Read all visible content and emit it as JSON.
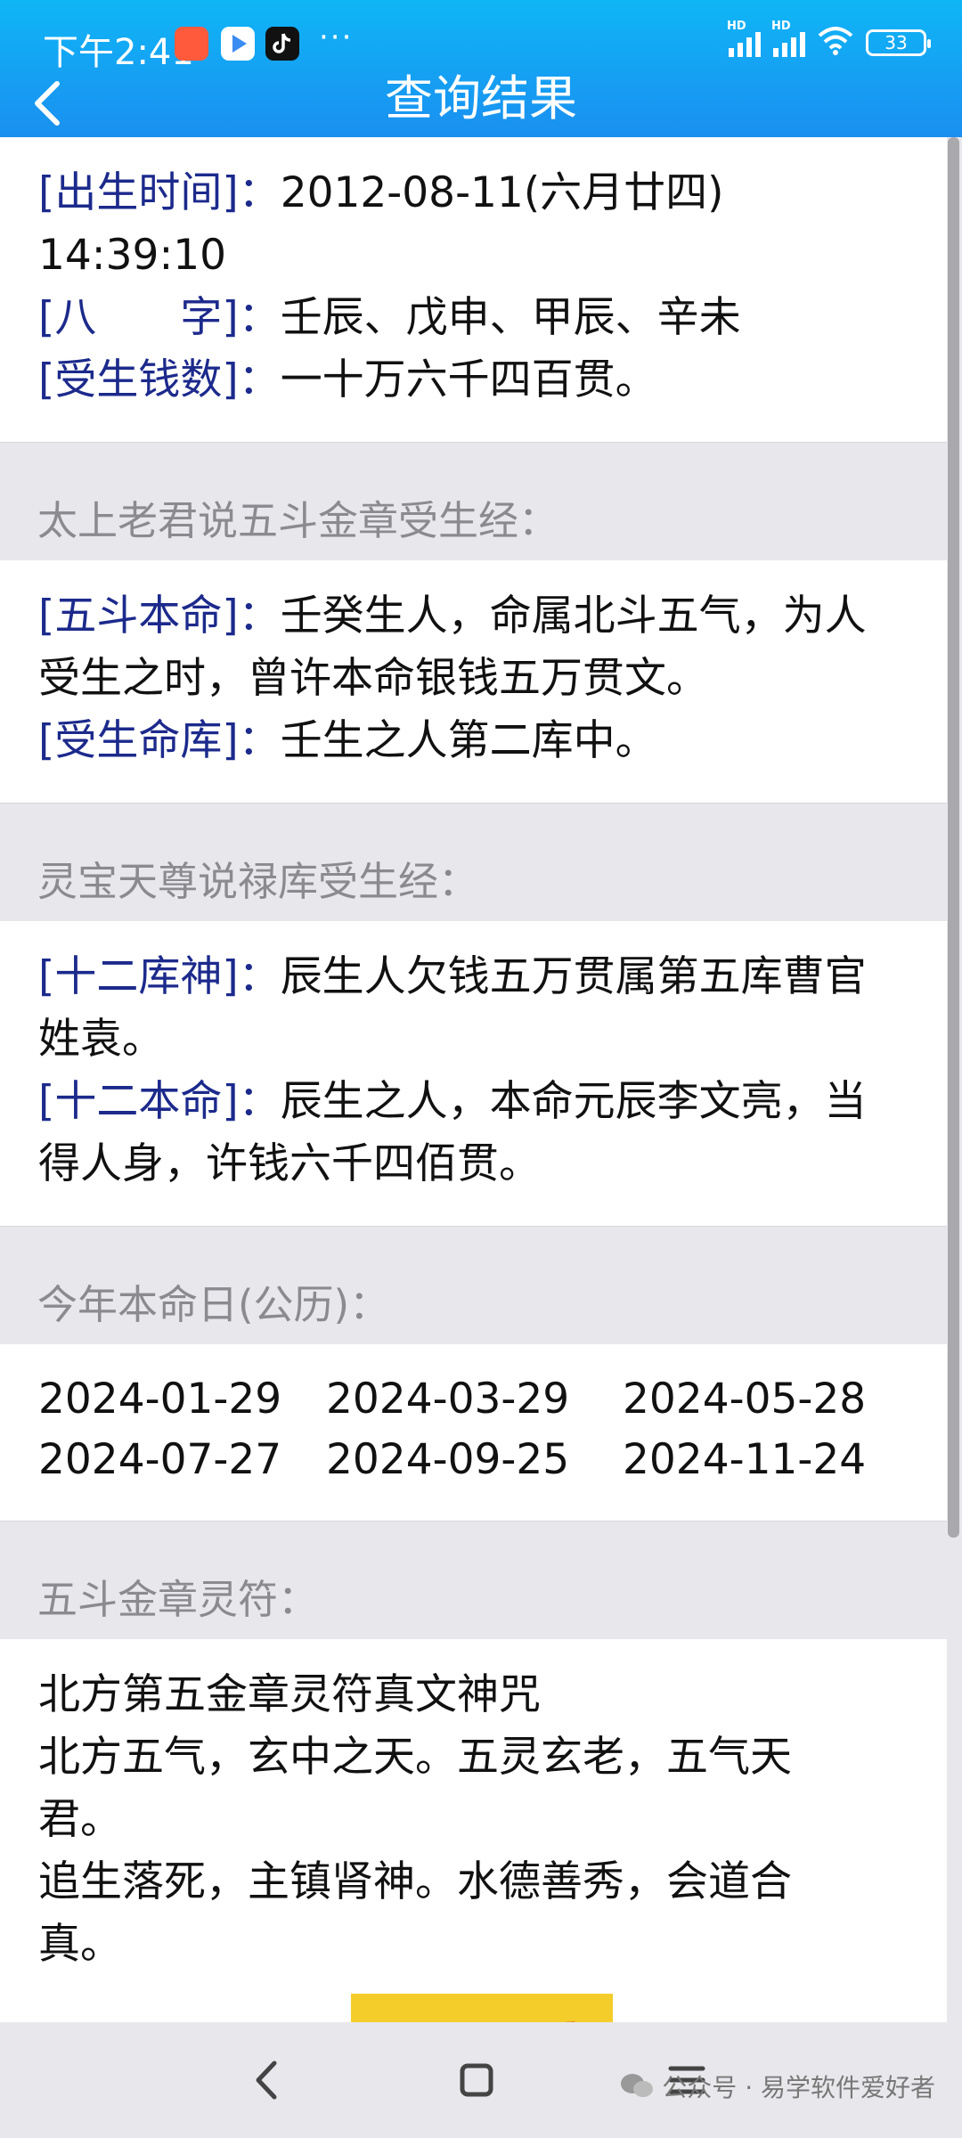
{
  "status_bar": {
    "time": "下午2:41",
    "dots": "···",
    "battery": "33",
    "hd": "HD"
  },
  "header": {
    "title": "查询结果"
  },
  "info": {
    "birth_label": "[出生时间]：",
    "birth_value": "2012-08-11(六月廿四) 14:39:10",
    "bazi_label": "[八　　字]：",
    "bazi_value": "壬辰、戊申、甲辰、辛未",
    "money_label": "[受生钱数]：",
    "money_value": "一十万六千四百贯。"
  },
  "section_wudou": {
    "heading": "太上老君说五斗金章受生经：",
    "benming_label": "[五斗本命]：",
    "benming_line1": "壬癸生人，命属北斗五气，为人",
    "benming_line2": "受生之时，曾许本命银钱五万贯文。",
    "mingku_label": "[受生命库]：",
    "mingku_value": "壬生之人第二库中。"
  },
  "section_lingbao": {
    "heading": "灵宝天尊说禄库受生经：",
    "kushen_label": "[十二库神]：",
    "kushen_line1": "辰生人欠钱五万贯属第五库曹官",
    "kushen_line2": "姓袁。",
    "benming_label": "[十二本命]：",
    "benming_line1": "辰生之人，本命元辰李文亮，当",
    "benming_line2": "得人身，许钱六千四佰贯。"
  },
  "section_dates": {
    "heading": "今年本命日(公历)：",
    "dates": [
      "2024-01-29",
      "2024-03-29",
      "2024-05-28",
      "2024-07-27",
      "2024-09-25",
      "2024-11-24"
    ]
  },
  "section_fu": {
    "heading": "五斗金章灵符：",
    "lines": [
      "北方第五金章灵符真文神咒",
      "北方五气，玄中之天。五灵玄老，五气天",
      "君。",
      "追生落死，主镇肾神。水德善秀，会道合",
      "真。"
    ]
  },
  "watermark": "公众号 · 易学软件爱好者",
  "colors": {
    "header_top": "#0fb6f6",
    "header_bottom": "#1a8ff0",
    "label_blue": "#1c2a8c",
    "heading_gray": "#8a8a8f",
    "talisman_yellow": "#f4cd2a",
    "talisman_red": "#d8402a"
  },
  "icons": {
    "back": "chevron-left-icon",
    "nav_back": "nav-back-icon",
    "nav_home": "nav-home-icon",
    "nav_menu": "nav-menu-icon"
  }
}
